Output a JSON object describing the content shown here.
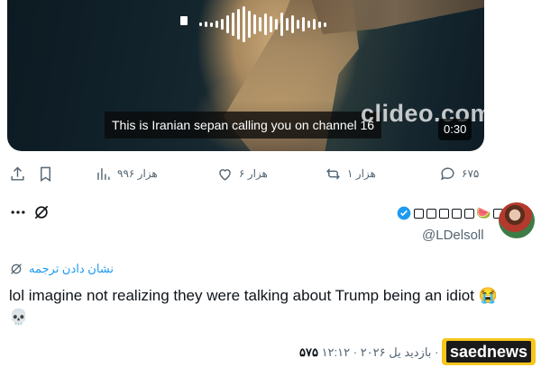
{
  "video": {
    "caption": "This is Iranian sepan calling you on channel 16",
    "watermark": "clideo.com",
    "duration": "0:30"
  },
  "actions": {
    "views": "۹۹۶ هزار",
    "likes": "۶ هزار",
    "retweets": "۱ هزار",
    "replies": "۶۷۵"
  },
  "author": {
    "handle": "@LDelsoll",
    "name_emoji": "🍉"
  },
  "translate_label": "نشان دادن ترجمه",
  "tweet": {
    "text": "lol imagine not realizing they were talking about Trump being an idiot",
    "emoji_end": "😭",
    "emoji_second_line": "💀"
  },
  "meta": {
    "datetime": "یل ۲۰۲۶ · ۱۲:۱۲ ·",
    "views_label": "بازدید",
    "views_count": "۵۷۵"
  },
  "logo_text": "saednews",
  "colors": {
    "accent": "#1d9bf0",
    "muted": "#536471",
    "logo_bg": "#f6c61c"
  }
}
